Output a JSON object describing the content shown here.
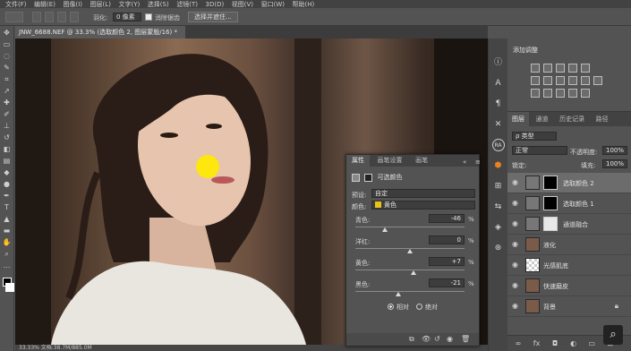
{
  "menubar": {
    "items": [
      "文件(F)",
      "编辑(E)",
      "图像(I)",
      "图层(L)",
      "文字(Y)",
      "选择(S)",
      "滤镜(T)",
      "3D(D)",
      "视图(V)",
      "窗口(W)",
      "帮助(H)"
    ]
  },
  "options": {
    "feather_label": "羽化:",
    "feather_value": "0 像素",
    "antialias_label": "消除锯齿",
    "select_subject": "选择并遮住..."
  },
  "document": {
    "tab_title": "JNW_6688.NEF @ 33.3% (选取颜色 2, 图层蒙版/16) *",
    "status": "33.33%    文档:38.7M/885.0M"
  },
  "adjustments": {
    "title": "添加调整"
  },
  "layers_panel": {
    "tabs": [
      "图层",
      "通道",
      "历史记录",
      "路径"
    ],
    "filter_kind": "ρ 类型",
    "blend_mode": "正常",
    "opacity_label": "不透明度:",
    "opacity_value": "100%",
    "lock_label": "锁定:",
    "fill_label": "填充:",
    "fill_value": "100%",
    "layers": [
      {
        "name": "选取颜色 2",
        "selected": true,
        "type": "adjust"
      },
      {
        "name": "选取颜色 1",
        "selected": false,
        "type": "adjust"
      },
      {
        "name": "通道融合",
        "selected": false,
        "type": "adjust"
      },
      {
        "name": "液化",
        "selected": false,
        "type": "photo"
      },
      {
        "name": "光感肌底",
        "selected": false,
        "type": "empty"
      },
      {
        "name": "快速磨皮",
        "selected": false,
        "type": "photo"
      },
      {
        "name": "背景",
        "selected": false,
        "type": "photo"
      }
    ]
  },
  "properties": {
    "tabs": [
      "属性",
      "画笔设置",
      "画笔"
    ],
    "header": "可选颜色",
    "preset_label": "预设:",
    "preset_value": "自定",
    "colors_label": "颜色:",
    "colors_value": "黄色",
    "sliders": [
      {
        "label": "青色:",
        "value": "-46",
        "pos": 0.27
      },
      {
        "label": "洋红:",
        "value": "0",
        "pos": 0.5
      },
      {
        "label": "黄色:",
        "value": "+7",
        "pos": 0.535
      },
      {
        "label": "黑色:",
        "value": "-21",
        "pos": 0.395
      }
    ],
    "pct": "%",
    "relative_label": "相对",
    "absolute_label": "绝对",
    "method_selected": "相对"
  },
  "right_strip_icons": [
    "info-icon",
    "character-icon",
    "paragraph-icon",
    "tools-icon",
    "ra-icon",
    "3d-icon",
    "adjust-icon",
    "adjust2-icon",
    "layers-icon",
    "channels-icon"
  ],
  "colors": {
    "accent": "#ffe900",
    "swatch_yellow": "#e8c219"
  }
}
